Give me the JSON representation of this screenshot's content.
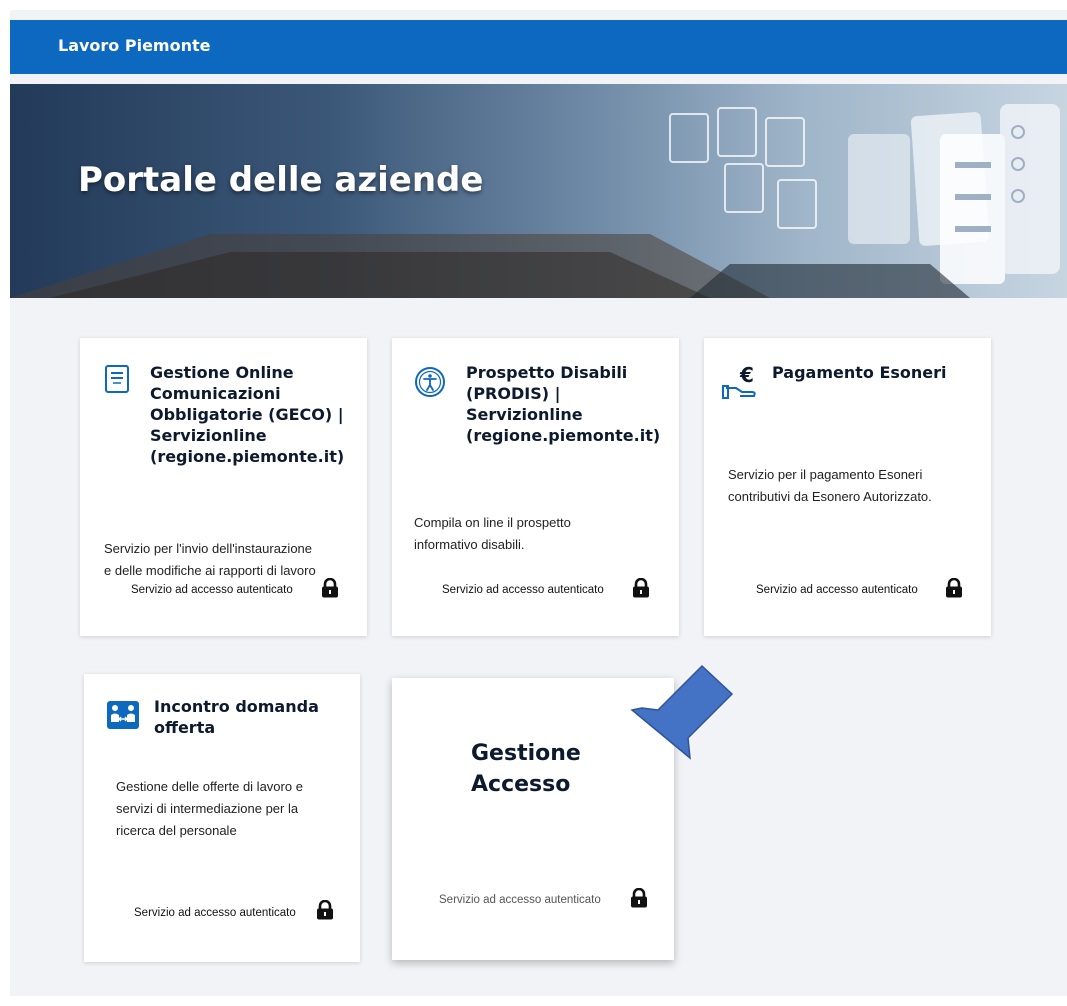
{
  "topbar": {
    "title": "Lavoro Piemonte"
  },
  "hero": {
    "title": "Portale delle aziende"
  },
  "cards": [
    {
      "title": "Gestione Online Comunicazioni Obbligatorie (GECO) | Servizionline (regione.piemonte.it)",
      "title_lines": [
        "Gestione Online",
        "Comunicazioni",
        "Obbligatorie (GECO) |",
        "Servizionline",
        "(regione.piemonte.it)"
      ],
      "description_lines": [
        "Servizio per l'invio dell'instaurazione",
        "e delle modifiche ai rapporti di lavoro"
      ],
      "footer": "Servizio ad accesso autenticato",
      "icon": "document-icon"
    },
    {
      "title": "Prospetto Disabili (PRODIS) | Servizionline (regione.piemonte.it)",
      "title_lines": [
        "Prospetto Disabili",
        "(PRODIS) |",
        "Servizionline",
        "(regione.piemonte.it)"
      ],
      "description_lines": [
        "Compila on line il prospetto",
        "informativo disabili."
      ],
      "footer": "Servizio ad accesso autenticato",
      "icon": "accessibility-icon"
    },
    {
      "title": "Pagamento Esoneri",
      "title_lines": [
        "Pagamento Esoneri"
      ],
      "description_lines": [
        "Servizio per il pagamento Esoneri",
        "contributivi da Esonero Autorizzato."
      ],
      "footer": "Servizio ad accesso autenticato",
      "icon": "euro-hand-icon"
    },
    {
      "title": "Incontro domanda offerta",
      "title_lines": [
        "Incontro domanda",
        "offerta"
      ],
      "description_lines": [
        "Gestione delle offerte di lavoro e",
        "servizi di intermediazione per la",
        "ricerca del personale"
      ],
      "footer": "Servizio ad accesso autenticato",
      "icon": "people-exchange-icon"
    },
    {
      "title": "Gestione Accesso",
      "title_lines": [
        "Gestione",
        "Accesso"
      ],
      "description_lines": [],
      "footer": "Servizio ad accesso autenticato",
      "icon": ""
    }
  ],
  "colors": {
    "topbar": "#0d68c0",
    "icon_blue": "#0d68c0",
    "arrow": "#4472c4",
    "page_bg": "#f1f3f6"
  },
  "annotation": {
    "shape": "arrow-pointing-down-left",
    "icon": "arrow-annotation-icon"
  }
}
